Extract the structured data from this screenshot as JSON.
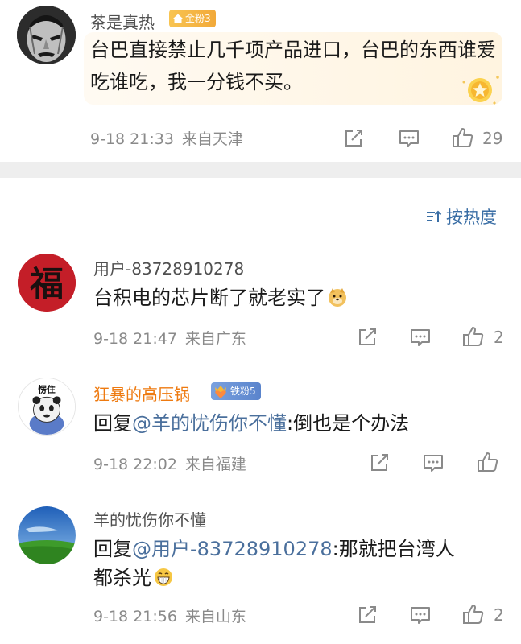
{
  "top_comment": {
    "username": "茶是真热",
    "badge": "金粉3",
    "text": "台巴直接禁止几千项产品进口，台巴的东西谁爱吃谁吃，我一分钱不买。",
    "time": "9-18 21:33",
    "location": "来自天津",
    "likes": "29"
  },
  "sort": {
    "label": "按热度",
    "icon": "sort-lines-icon"
  },
  "comments": [
    {
      "username": "用户-83728910278",
      "text": "台积电的芯片断了就老实了",
      "emoji": "doge-emoji",
      "time": "9-18 21:47",
      "location": "来自广东",
      "likes": "2"
    },
    {
      "username": "狂暴的高压锅",
      "badge": "铁粉5",
      "avatar_text": "愣住",
      "reply_prefix": "回复",
      "mention": "@羊的忧伤你不懂",
      "text": ":倒也是个办法",
      "time": "9-18 22:02",
      "location": "来自福建",
      "likes": ""
    },
    {
      "username": "羊的忧伤你不懂",
      "reply_prefix": "回复",
      "mention": "@用户-83728910278",
      "text_line1": ":那就把台湾人",
      "text_line2": "都杀光",
      "emoji": "grin-emoji",
      "time": "9-18 21:56",
      "location": "来自山东",
      "likes": "2"
    }
  ],
  "colors": {
    "mention": "#4a6f9c",
    "orange_name": "#ee7a10",
    "meta_gray": "#8a8a8a",
    "divider": "#eeeeee"
  }
}
